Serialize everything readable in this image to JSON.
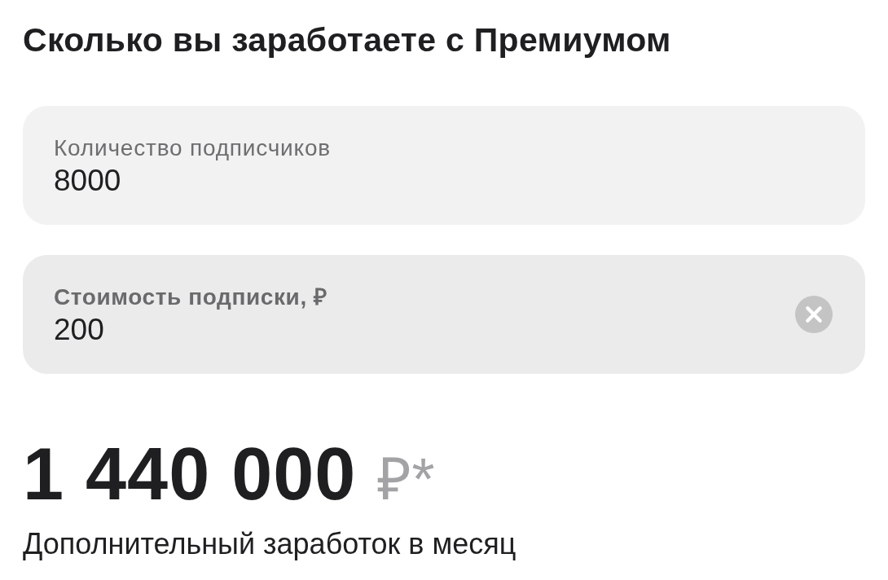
{
  "heading": "Сколько вы заработаете с Премиумом",
  "fields": [
    {
      "label": "Количество подписчиков",
      "value": "8000",
      "focused": false
    },
    {
      "label": "Стоимость подписки, ₽",
      "value": "200",
      "focused": true
    }
  ],
  "result": {
    "amount": "1 440 000",
    "currency": "₽*"
  },
  "caption": "Дополнительный заработок в месяц"
}
